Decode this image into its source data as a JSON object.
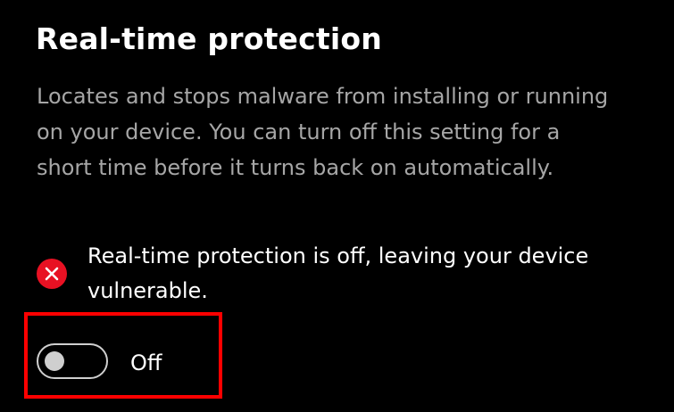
{
  "section": {
    "title": "Real-time protection",
    "description": "Locates and stops malware from installing or running on your device. You can turn off this setting for a short time before it turns back on automatically."
  },
  "status": {
    "icon": "error-x-icon",
    "text": "Real-time protection is off, leaving your device vulnerable.",
    "color": "#e81123"
  },
  "toggle": {
    "state": "off",
    "label": "Off"
  },
  "highlight": {
    "color": "#ff0000"
  }
}
